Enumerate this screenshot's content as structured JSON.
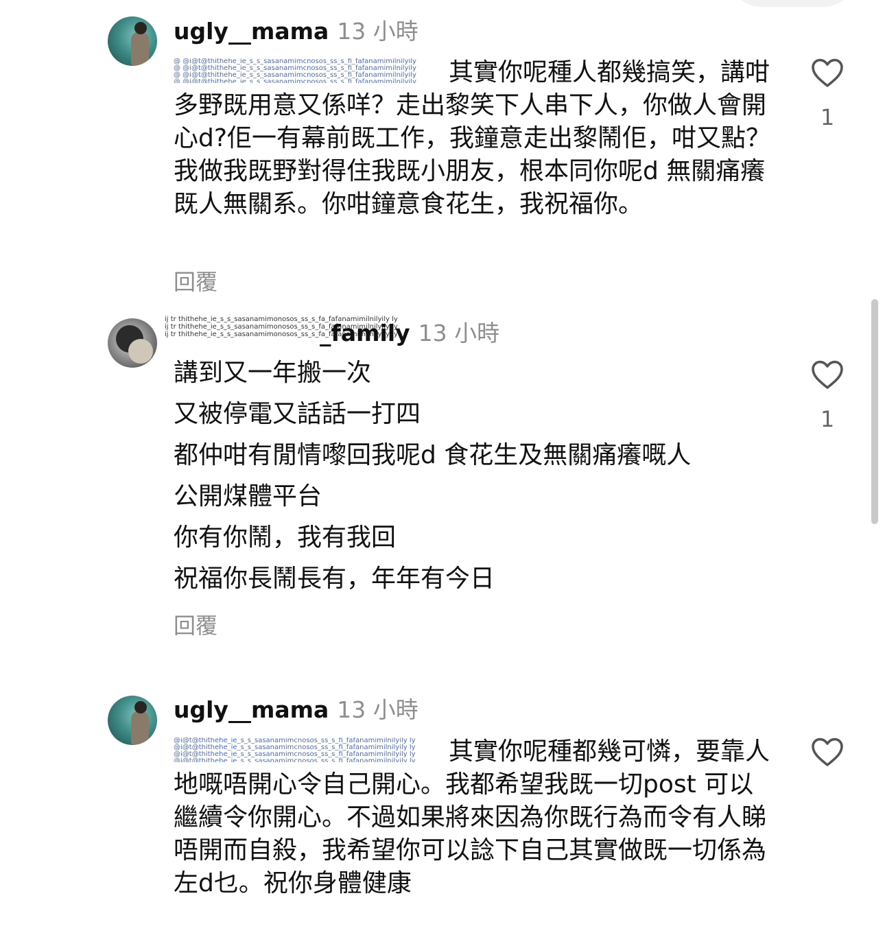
{
  "comments": [
    {
      "username": "ugly__mama",
      "time": "13 小時",
      "mention": "@",
      "text": "其實你呢種人都幾搞笑，講咁多野既用意又係咩？走出黎笑下人串下人，你做人會開心d?佢一有幕前既工作，我鐘意走出黎鬧佢，咁又點？我做我既野對得住我既小朋友，根本同你呢d 無關痛癢既人無關系。你咁鐘意食花生，我祝福你。",
      "reply": "回覆",
      "likes": "1"
    },
    {
      "username": "_family",
      "time": "13 小時",
      "lines": [
        "講到又一年搬一次",
        "又被停電又話話一打四",
        "都仲咁有閒情嚟回我呢d 食花生及無關痛癢嘅人",
        "公開煤體平台",
        "你有你鬧，我有我回",
        "祝福你長鬧長有，年年有今日"
      ],
      "reply": "回覆",
      "likes": "1"
    },
    {
      "username": "ugly__mama",
      "time": "13 小時",
      "mention": "@",
      "text": "其實你呢種都幾可憐，要靠人地嘅唔開心令自己開心。我都希望我既一切post 可以繼續令你開心。不過如果將來因為你既行為而令有人睇唔開而自殺，我希望你可以諗下自己其實做既一切係為左d乜。祝你身體健康"
    }
  ],
  "icons": {
    "like": "heart-outline-icon"
  },
  "colors": {
    "text": "#111111",
    "meta": "#8e8e8e",
    "mention": "#3a5fb0"
  }
}
